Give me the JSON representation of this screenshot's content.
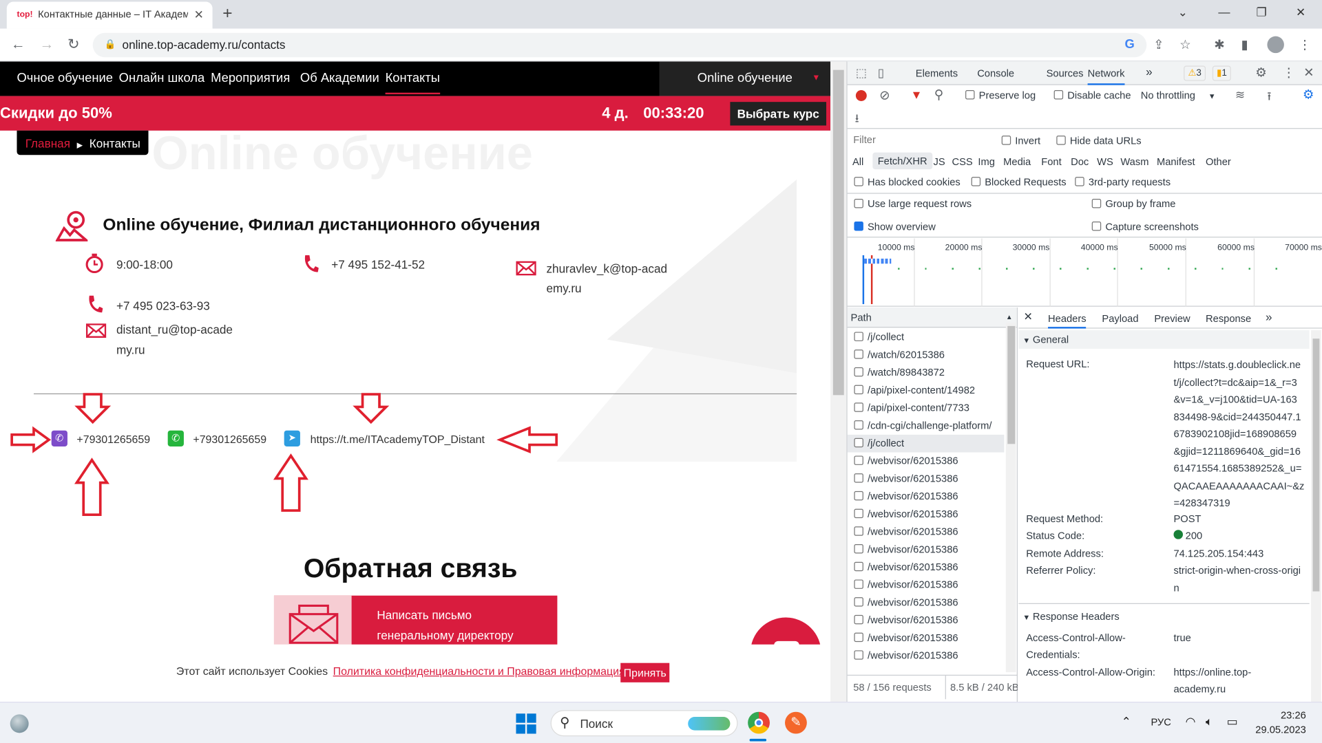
{
  "browser": {
    "tab_title": "Контактные данные – IT Академ",
    "favicon_text": "top!",
    "url": "online.top-academy.ru/contacts"
  },
  "site": {
    "nav": [
      "Очное обучение",
      "Онлайн школа",
      "Мероприятия",
      "Об Академии",
      "Контакты"
    ],
    "online_button": "Online обучение",
    "promo_text": "Скидки до 50%",
    "promo_days": "4 д.",
    "promo_timer": "00:33:20",
    "promo_button": "Выбрать курс",
    "breadcrumb_home": "Главная",
    "breadcrumb_current": "Контакты",
    "office_title": "Online обучение, Филиал дистанционного обучения",
    "hours": "9:00-18:00",
    "phone1": "+7 495 152-41-52",
    "email1_line1": "zhuravlev_k@top-acad",
    "email1_line2": "emy.ru",
    "phone2": "+7 495 023-63-93",
    "email2_line1": "distant_ru@top-acade",
    "email2_line2": "my.ru",
    "viber_phone": "+79301265659",
    "whatsapp_phone": "+79301265659",
    "telegram_link": "https://t.me/ITAcademyTOP_Distant",
    "feedback_title": "Обратная связь",
    "feedback_button_line1": "Написать письмо",
    "feedback_button_line2": "генеральному директору",
    "cookie_text": "Этот сайт использует Cookies",
    "cookie_link": "Политика конфиденциальности и Правовая информация",
    "cookie_accept": "Принять"
  },
  "devtools": {
    "tabs": [
      "Elements",
      "Console",
      "Sources",
      "Network"
    ],
    "warn_count": "3",
    "issue_count": "1",
    "preserve_log": "Preserve log",
    "disable_cache": "Disable cache",
    "throttling": "No throttling",
    "filter_placeholder": "Filter",
    "invert": "Invert",
    "hide_data_urls": "Hide data URLs",
    "type_filters": [
      "All",
      "Fetch/XHR",
      "JS",
      "CSS",
      "Img",
      "Media",
      "Font",
      "Doc",
      "WS",
      "Wasm",
      "Manifest",
      "Other"
    ],
    "has_blocked_cookies": "Has blocked cookies",
    "blocked_requests": "Blocked Requests",
    "third_party": "3rd-party requests",
    "use_large_rows": "Use large request rows",
    "group_by_frame": "Group by frame",
    "show_overview": "Show overview",
    "capture_screenshots": "Capture screenshots",
    "timeline_ticks": [
      "10000 ms",
      "20000 ms",
      "30000 ms",
      "40000 ms",
      "50000 ms",
      "60000 ms",
      "70000 ms"
    ],
    "path_header": "Path",
    "requests": [
      "/j/collect",
      "/watch/62015386",
      "/watch/89843872",
      "/api/pixel-content/14982",
      "/api/pixel-content/7733",
      "/cdn-cgi/challenge-platform/",
      "/j/collect",
      "/webvisor/62015386",
      "/webvisor/62015386",
      "/webvisor/62015386",
      "/webvisor/62015386",
      "/webvisor/62015386",
      "/webvisor/62015386",
      "/webvisor/62015386",
      "/webvisor/62015386",
      "/webvisor/62015386",
      "/webvisor/62015386",
      "/webvisor/62015386",
      "/webvisor/62015386"
    ],
    "detail_tabs": [
      "Headers",
      "Payload",
      "Preview",
      "Response"
    ],
    "general_label": "General",
    "request_url_key": "Request URL:",
    "request_url_lines": [
      "https://stats.g.doubleclick.ne",
      "t/j/collect?t=dc&aip=1&_r=3",
      "&v=1&_v=j100&tid=UA-163",
      "834498-9&cid=244350447.1",
      "6783902108jid=168908659",
      "&gjid=1211869640&_gid=16",
      "61471554.1685389252&_u=",
      "QACAAEAAAAAAACAAI~&z",
      "=428347319"
    ],
    "request_method_key": "Request Method:",
    "request_method": "POST",
    "status_code_key": "Status Code:",
    "status_code": "200",
    "remote_address_key": "Remote Address:",
    "remote_address": "74.125.205.154:443",
    "referrer_policy_key": "Referrer Policy:",
    "referrer_policy_lines": [
      "strict-origin-when-cross-origi",
      "n"
    ],
    "response_headers_label": "Response Headers",
    "acac_key_lines": [
      "Access-Control-Allow-",
      "Credentials:"
    ],
    "acac_value": "true",
    "acao_key": "Access-Control-Allow-Origin:",
    "acao_lines": [
      "https://online.top-",
      "academy.ru"
    ],
    "summary_requests": "58 / 156 requests",
    "summary_size": "8.5 kB / 240 kB"
  },
  "taskbar": {
    "search": "Поиск",
    "lang": "РУС",
    "time": "23:26",
    "date": "29.05.2023"
  },
  "colors": {
    "brand_red": "#d91c3e",
    "devtools_blue": "#1a73e8"
  }
}
